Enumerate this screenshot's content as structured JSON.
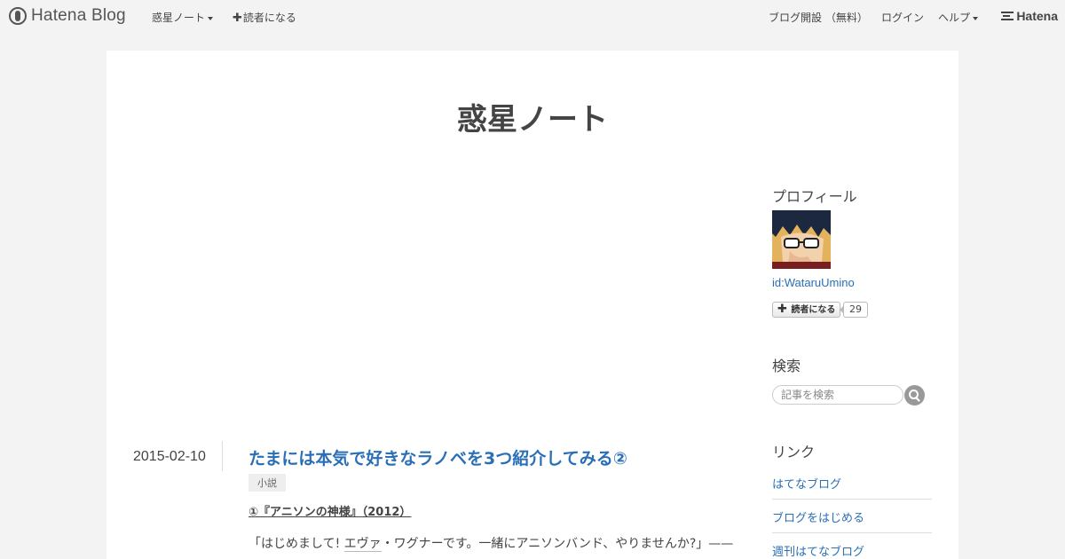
{
  "global_header": {
    "logo_text": "Hatena Blog",
    "blog_menu_label": "惑星ノート",
    "subscribe_label": "読者になる",
    "open_blog_label": "ブログ開設 （無料）",
    "login_label": "ログイン",
    "help_label": "ヘルプ",
    "hatena_label": "Hatena"
  },
  "blog": {
    "title": "惑星ノート"
  },
  "entry": {
    "date": "2015-02-10",
    "title": "たまには本気で好きなラノベを3つ紹介してみる②",
    "category": "小説",
    "subheading": "①『アニソンの神様』（2012）",
    "body_pre": "「はじめまして! ",
    "body_keyword": "エヴァ",
    "body_post": "・ワグナーです。一緒にアニソンバンド、やりませんか?」——"
  },
  "sidebar": {
    "profile": {
      "heading": "プロフィール",
      "id": "id:WataruUmino",
      "subscribe_label": "読者になる",
      "subscriber_count": "29"
    },
    "search": {
      "heading": "検索",
      "placeholder": "記事を検索"
    },
    "links": {
      "heading": "リンク",
      "items": [
        "はてなブログ",
        "ブログをはじめる",
        "週刊はてなブログ"
      ]
    }
  },
  "colors": {
    "link": "#2a6fb6",
    "page_background": "#f3f3f3"
  }
}
